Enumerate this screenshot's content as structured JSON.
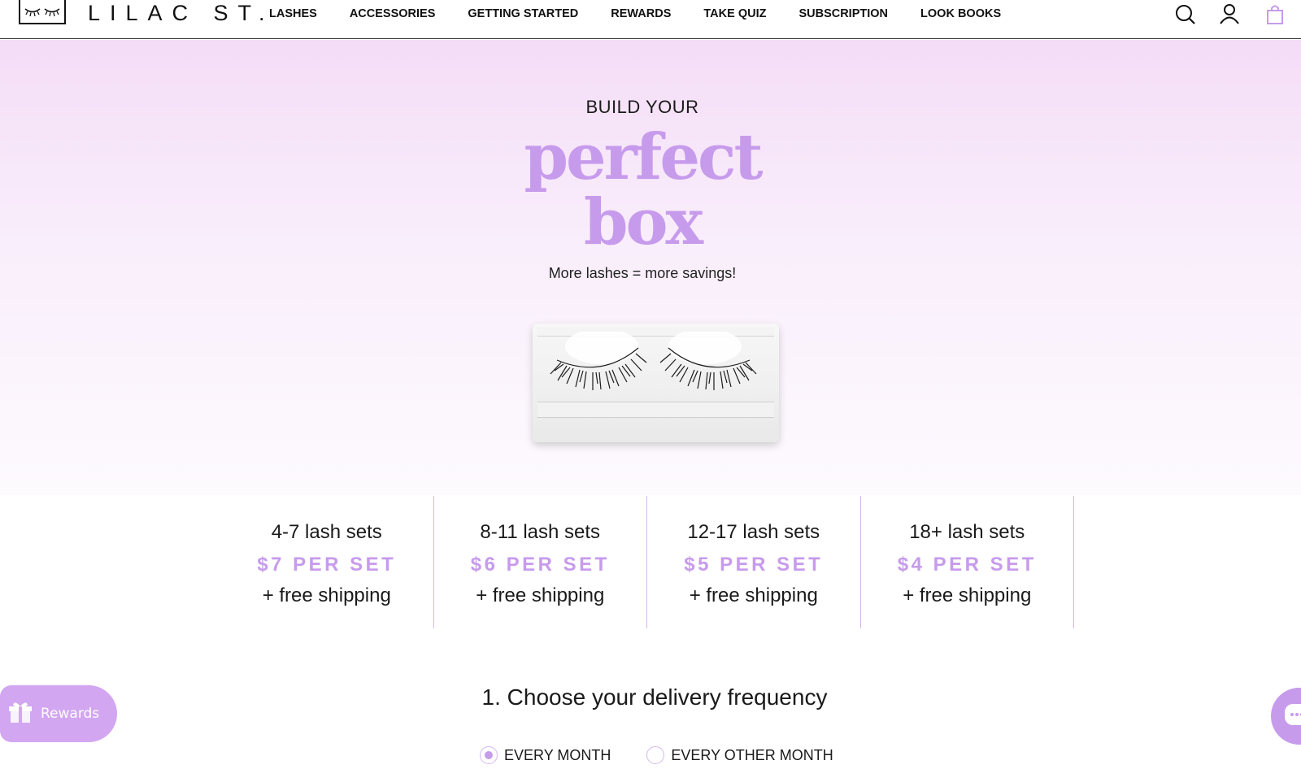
{
  "header": {
    "brand": "LILAC ST.",
    "nav": [
      "LASHES",
      "ACCESSORIES",
      "GETTING STARTED",
      "REWARDS",
      "TAKE QUIZ",
      "SUBSCRIPTION",
      "LOOK BOOKS"
    ],
    "icons": [
      "search-icon",
      "account-icon",
      "cart-icon"
    ]
  },
  "hero": {
    "kicker": "BUILD YOUR",
    "script_line1": "perfect",
    "script_line2": "box",
    "tagline": "More lashes = more savings!"
  },
  "tiers": [
    {
      "range": "4-7 lash sets",
      "price": "$7 PER SET",
      "shipping": "+ free shipping"
    },
    {
      "range": "8-11 lash sets",
      "price": "$6 PER SET",
      "shipping": "+ free shipping"
    },
    {
      "range": "12-17 lash sets",
      "price": "$5 PER SET",
      "shipping": "+ free shipping"
    },
    {
      "range": "18+ lash sets",
      "price": "$4 PER SET",
      "shipping": "+ free shipping"
    }
  ],
  "frequency": {
    "title": "1. Choose your delivery frequency",
    "options": [
      {
        "label": "EVERY MONTH",
        "checked": true
      },
      {
        "label": "EVERY OTHER MONTH",
        "checked": false
      }
    ]
  },
  "floating": {
    "rewards_label": "Rewards"
  },
  "colors": {
    "accent": "#c79bec",
    "hero_top": "#f4ddf7",
    "divider": "#d6b5ee"
  }
}
